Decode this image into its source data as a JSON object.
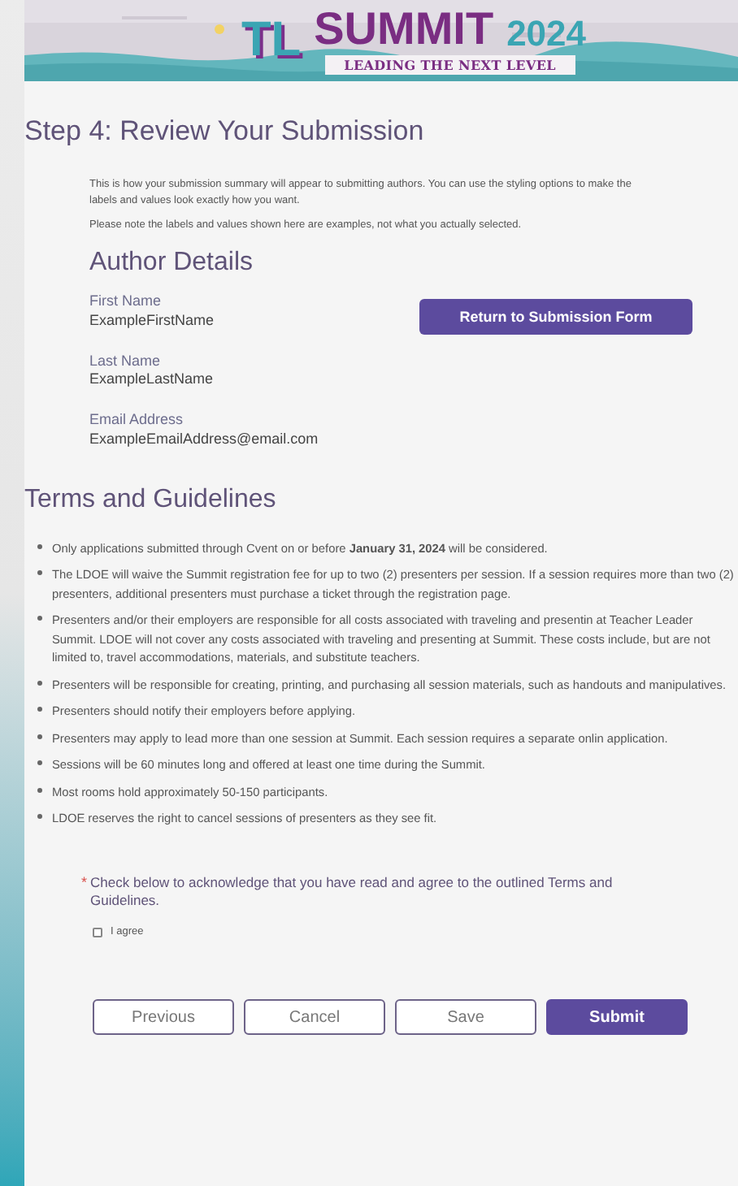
{
  "banner": {
    "logo_letters": "TL",
    "title": "SUMMIT",
    "year": "2024",
    "tagline": "LEADING THE NEXT LEVEL"
  },
  "page_title": "Step 4: Review Your Submission",
  "intro": [
    "This is how your submission summary will appear to submitting authors. You can use the styling options to make the labels and values look exactly how you want.",
    "Please note the labels and values shown here are examples, not what you actually selected."
  ],
  "author_details": {
    "heading": "Author Details",
    "fields": [
      {
        "label": "First Name",
        "value": "ExampleFirstName"
      },
      {
        "label": "Last Name",
        "value": "ExampleLastName"
      },
      {
        "label": "Email Address",
        "value": "ExampleEmailAddress@email.com"
      }
    ],
    "return_button": "Return to Submission Form"
  },
  "terms": {
    "heading": "Terms and Guidelines",
    "items": [
      "Only applications submitted through Cvent on or before **January 31, 2024** will be considered.",
      "The LDOE will waive the Summit registration fee for up to two (2) presenters per session. If a session requires more than two (2) presenters, additional presenters must purchase a ticket through the registration page.",
      "Presenters and/or their employers are responsible for all costs associated with traveling and presentin at Teacher Leader Summit. LDOE will not cover any costs associated with traveling and presenting at Summit. These costs include, but are not limited to, travel accommodations, materials, and substitute teachers.",
      "Presenters will be responsible for creating, printing, and purchasing all session materials, such as handouts and manipulatives.",
      "Presenters should notify their employers before applying.",
      "Presenters may apply to lead more than one session at Summit. Each session requires a separate onlin application.",
      "Sessions will be 60 minutes long and offered at least one  time during the Summit.",
      "Most rooms hold approximately 50-150 participants.",
      "LDOE reserves the right to cancel sessions of presenters as they see fit."
    ]
  },
  "acknowledgement": {
    "required_mark": "*",
    "text": "Check below to acknowledge that you have read and agree to the outlined Terms and Guidelines.",
    "checkbox": {
      "label": "I agree",
      "checked": false
    }
  },
  "buttons": [
    {
      "label": "Previous",
      "kind": "outline"
    },
    {
      "label": "Cancel",
      "kind": "outline"
    },
    {
      "label": "Save",
      "kind": "outline"
    },
    {
      "label": "Submit",
      "kind": "primary"
    }
  ]
}
